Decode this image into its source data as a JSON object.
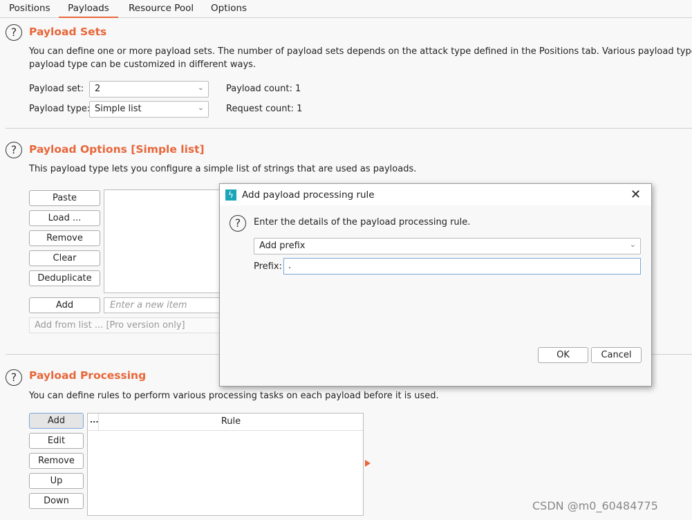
{
  "tabs": [
    "Positions",
    "Payloads",
    "Resource Pool",
    "Options"
  ],
  "active_tab": "Payloads",
  "accent": "#e8663a",
  "payload_sets": {
    "title": "Payload Sets",
    "desc1": "You can define one or more payload sets. The number of payload sets depends on the attack type defined in the Positions tab. Various payload types are ava",
    "desc2": "payload type can be customized in different ways.",
    "set_label": "Payload set:",
    "set_value": "2",
    "type_label": "Payload type:",
    "type_value": "Simple list",
    "payload_count": "Payload count: 1",
    "request_count": "Request count: 1"
  },
  "payload_options": {
    "title": "Payload Options [Simple list]",
    "desc": "This payload type lets you configure a simple list of strings that are used as payloads.",
    "buttons": [
      "Paste",
      "Load ...",
      "Remove",
      "Clear",
      "Deduplicate"
    ],
    "add_label": "Add",
    "new_item_placeholder": "Enter a new item",
    "add_from_list": "Add from list ... [Pro version only]"
  },
  "payload_processing": {
    "title": "Payload Processing",
    "desc": "You can define rules to perform various processing tasks on each payload before it is used.",
    "buttons": [
      "Add",
      "Edit",
      "Remove",
      "Up",
      "Down"
    ],
    "columns": [
      "...",
      "Rule"
    ]
  },
  "dialog": {
    "title": "Add payload processing rule",
    "intro": "Enter the details of the payload processing rule.",
    "rule_type": "Add prefix",
    "prefix_label": "Prefix:",
    "prefix_value": ".",
    "ok": "OK",
    "cancel": "Cancel"
  },
  "watermark": "CSDN @m0_60484775"
}
